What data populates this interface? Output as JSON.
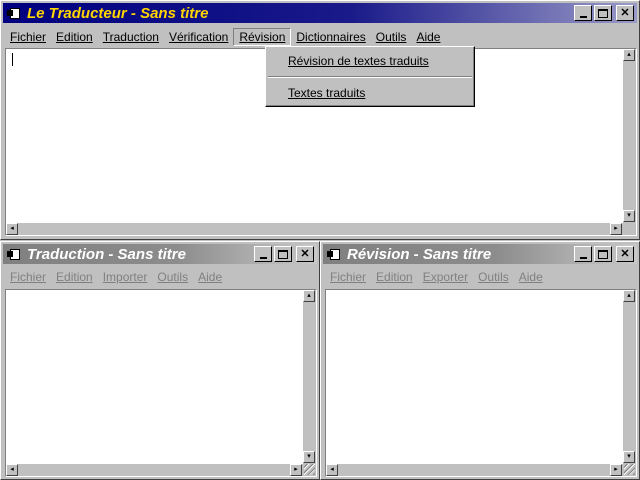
{
  "app": {
    "title": "Le Traducteur - Sans titre",
    "menu": [
      "Fichier",
      "Edition",
      "Traduction",
      "Vérification",
      "Révision",
      "Dictionnaires",
      "Outils",
      "Aide"
    ],
    "revision_menu": {
      "items": [
        "Révision de textes traduits",
        "Textes traduits"
      ]
    }
  },
  "translation_window": {
    "title": "Traduction - Sans titre",
    "menu": [
      "Fichier",
      "Edition",
      "Importer",
      "Outils",
      "Aide"
    ]
  },
  "revision_window": {
    "title": "Révision - Sans titre",
    "menu": [
      "Fichier",
      "Edition",
      "Exporter",
      "Outils",
      "Aide"
    ]
  },
  "colors": {
    "active_title": "#000080",
    "active_title_text": "#ffd500",
    "inactive_title": "#808080",
    "surface": "#c0c0c0"
  },
  "icons": {
    "window": "document-icon",
    "minimize": "minimize-icon",
    "maximize": "maximize-icon",
    "close": "close-icon"
  }
}
